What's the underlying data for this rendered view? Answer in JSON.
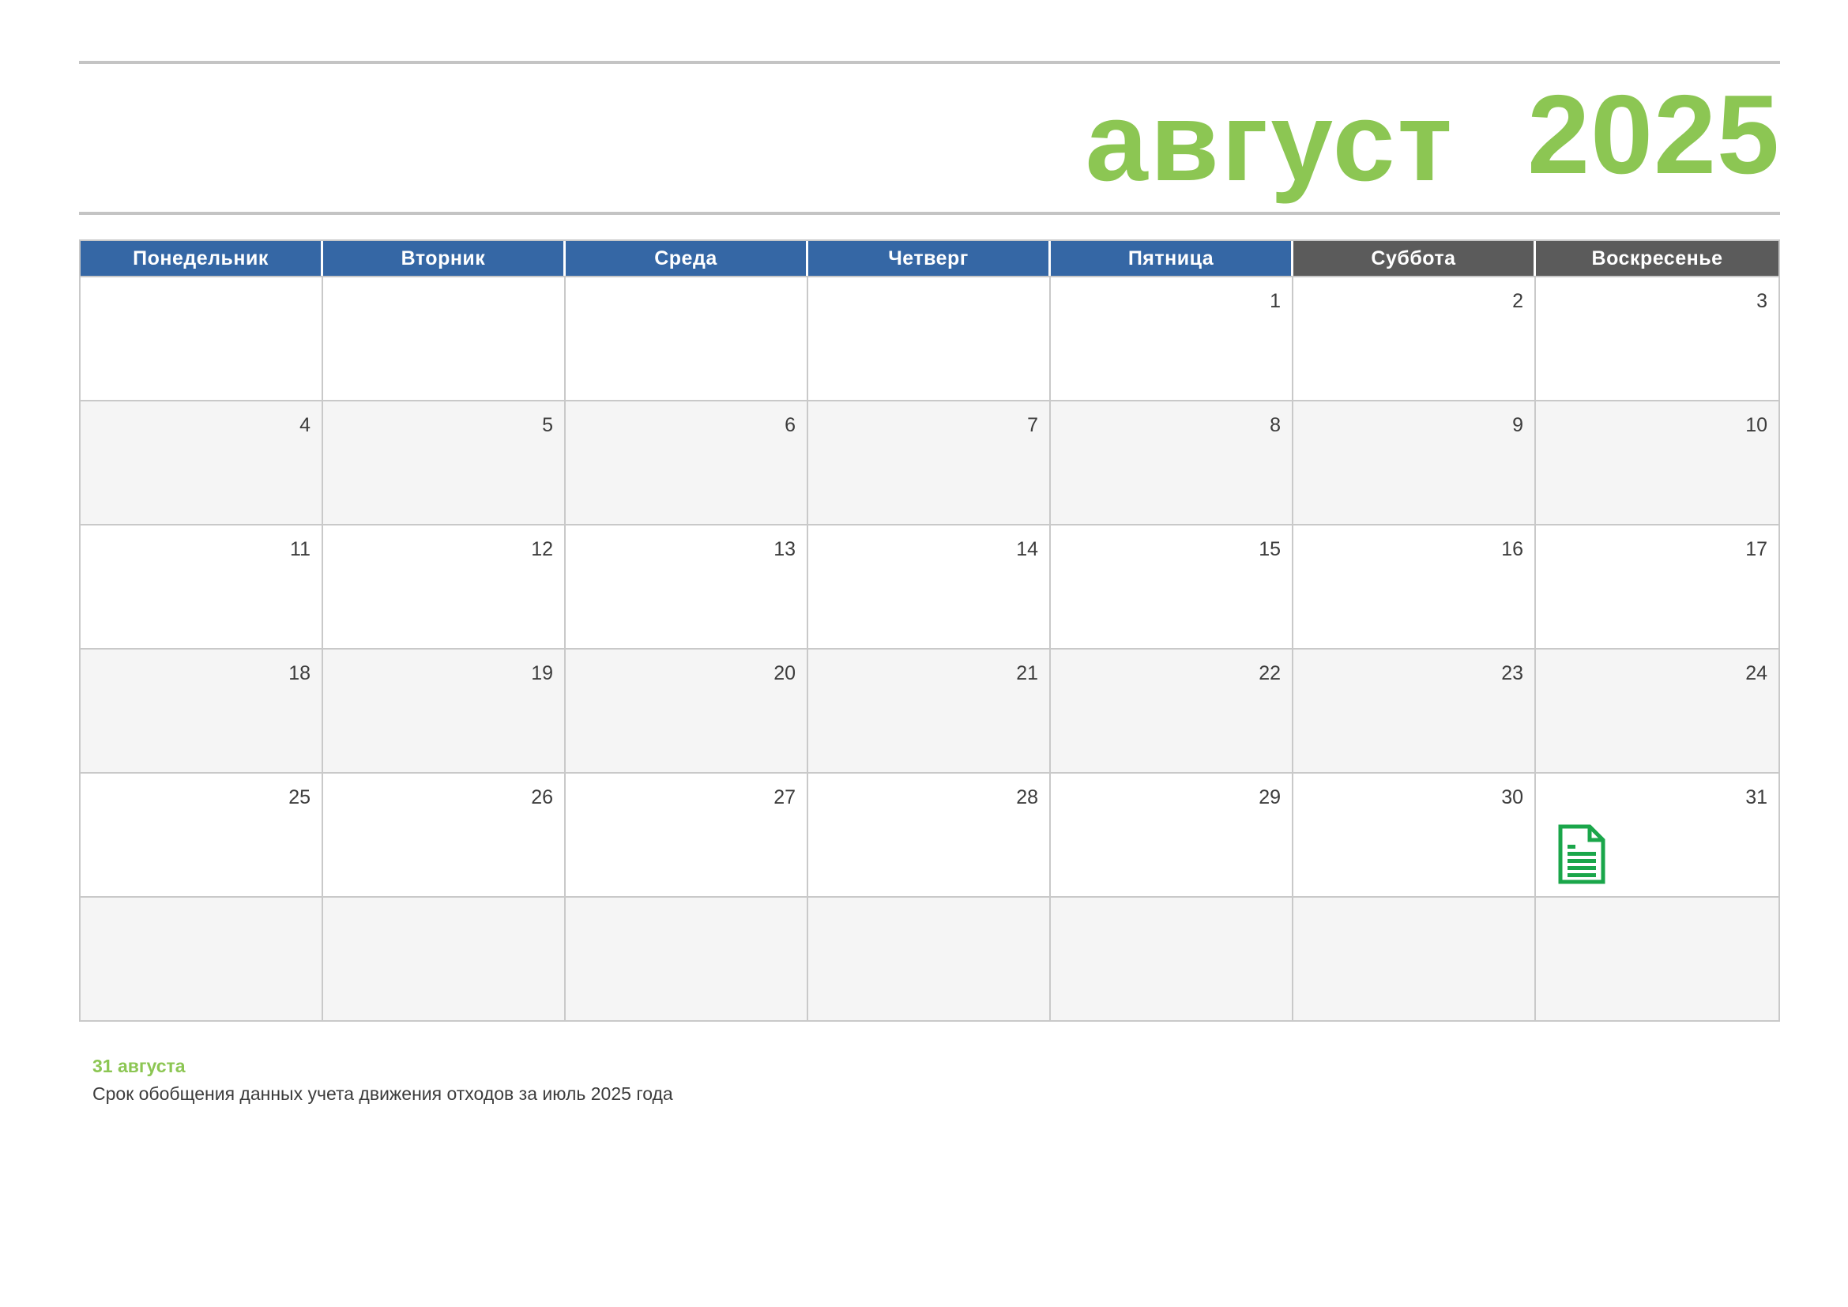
{
  "header": {
    "month": "август",
    "year": "2025"
  },
  "calendar": {
    "weekdays": [
      {
        "label": "Понедельник",
        "kind": "weekday"
      },
      {
        "label": "Вторник",
        "kind": "weekday"
      },
      {
        "label": "Среда",
        "kind": "weekday"
      },
      {
        "label": "Четверг",
        "kind": "weekday"
      },
      {
        "label": "Пятница",
        "kind": "weekday"
      },
      {
        "label": "Суббота",
        "kind": "weekend"
      },
      {
        "label": "Воскресенье",
        "kind": "weekend"
      }
    ],
    "weeks": [
      [
        "",
        "",
        "",
        "",
        "1",
        "2",
        "3"
      ],
      [
        "4",
        "5",
        "6",
        "7",
        "8",
        "9",
        "10"
      ],
      [
        "11",
        "12",
        "13",
        "14",
        "15",
        "16",
        "17"
      ],
      [
        "18",
        "19",
        "20",
        "21",
        "22",
        "23",
        "24"
      ],
      [
        "25",
        "26",
        "27",
        "28",
        "29",
        "30",
        "31"
      ],
      [
        "",
        "",
        "",
        "",
        "",
        "",
        ""
      ]
    ],
    "event_icon_day": "31",
    "event_icon": "document-icon"
  },
  "notes": [
    {
      "date": "31 августа",
      "text": "Срок обобщения данных учета движения отходов за июль 2025 года"
    }
  ],
  "colors": {
    "accent_green": "#8cc653",
    "weekday_header": "#3567a5",
    "weekend_header": "#5b5b5b",
    "icon_green": "#1aa64a"
  }
}
